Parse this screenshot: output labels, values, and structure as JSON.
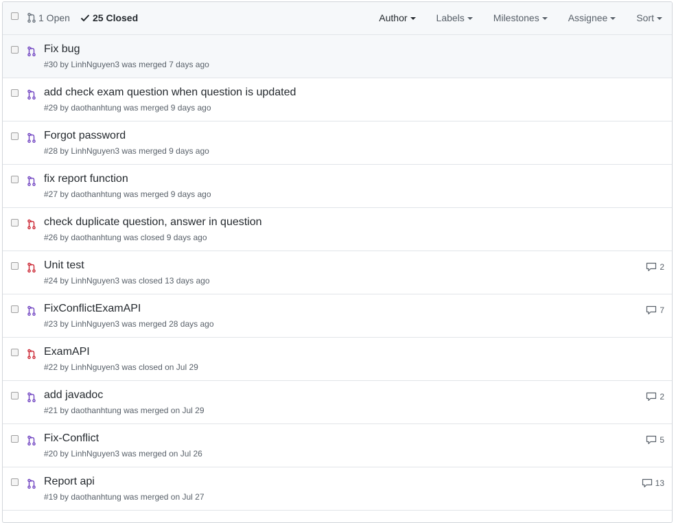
{
  "header": {
    "open_count_label": "1 Open",
    "closed_count_label": "25 Closed",
    "filters": [
      {
        "label": "Author",
        "active": true
      },
      {
        "label": "Labels",
        "active": false
      },
      {
        "label": "Milestones",
        "active": false
      },
      {
        "label": "Assignee",
        "active": false
      },
      {
        "label": "Sort",
        "active": false
      }
    ]
  },
  "colors": {
    "merged": "#6f42c1",
    "closed": "#cb2431"
  },
  "pull_requests": [
    {
      "title": "Fix bug",
      "meta": "#30 by LinhNguyen3 was merged 7 days ago",
      "state": "merged",
      "comments": ""
    },
    {
      "title": "add check exam question when question is updated",
      "meta": "#29 by daothanhtung was merged 9 days ago",
      "state": "merged",
      "comments": ""
    },
    {
      "title": "Forgot password",
      "meta": "#28 by LinhNguyen3 was merged 9 days ago",
      "state": "merged",
      "comments": ""
    },
    {
      "title": "fix report function",
      "meta": "#27 by daothanhtung was merged 9 days ago",
      "state": "merged",
      "comments": ""
    },
    {
      "title": "check duplicate question, answer in question",
      "meta": "#26 by daothanhtung was closed 9 days ago",
      "state": "closed",
      "comments": ""
    },
    {
      "title": "Unit test",
      "meta": "#24 by LinhNguyen3 was closed 13 days ago",
      "state": "closed",
      "comments": "2"
    },
    {
      "title": "FixConflictExamAPI",
      "meta": "#23 by LinhNguyen3 was merged 28 days ago",
      "state": "merged",
      "comments": "7"
    },
    {
      "title": "ExamAPI",
      "meta": "#22 by LinhNguyen3 was closed on Jul 29",
      "state": "closed",
      "comments": ""
    },
    {
      "title": "add javadoc",
      "meta": "#21 by daothanhtung was merged on Jul 29",
      "state": "merged",
      "comments": "2"
    },
    {
      "title": "Fix-Conflict",
      "meta": "#20 by LinhNguyen3 was merged on Jul 26",
      "state": "merged",
      "comments": "5"
    },
    {
      "title": "Report api",
      "meta": "#19 by daothanhtung was merged on Jul 27",
      "state": "merged",
      "comments": "13"
    }
  ]
}
